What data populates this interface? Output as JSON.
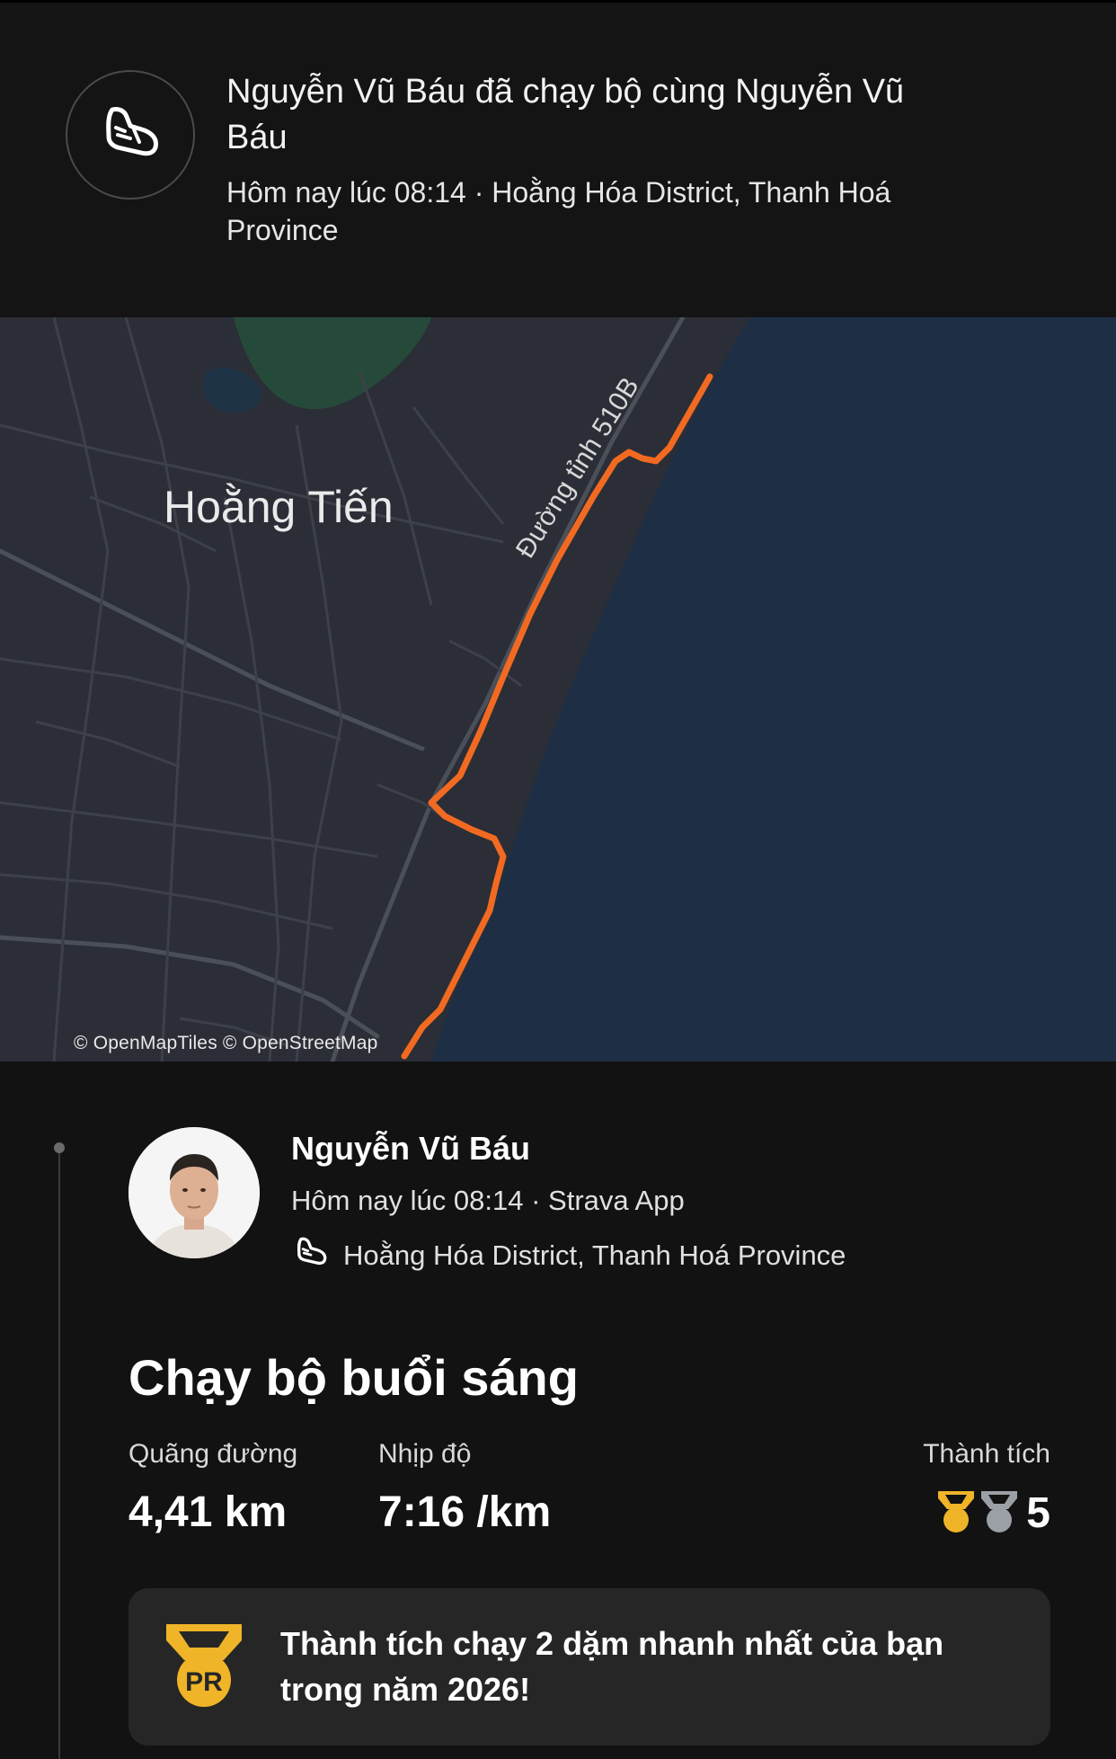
{
  "header": {
    "title": "Nguyễn Vũ Báu đã chạy bộ cùng Nguyễn Vũ Báu",
    "subtitle": "Hôm nay lúc 08:14 · Hoằng Hóa District, Thanh Hoá Province",
    "icon": "running-shoe-icon"
  },
  "map": {
    "place_label": "Hoằng Tiến",
    "road_label": "Đường tỉnh 510B",
    "credit": "© OpenMapTiles © OpenStreetMap",
    "route_color": "#f26a21",
    "water_color": "#1e2f45",
    "land_color": "#2b2e36"
  },
  "activity": {
    "athlete_name": "Nguyễn Vũ Báu",
    "meta": "Hôm nay lúc 08:14 · Strava App",
    "location": "Hoằng Hóa District, Thanh Hoá Province",
    "title": "Chạy bộ buổi sáng",
    "stats": {
      "distance_label": "Quãng đường",
      "distance_value": "4,41 km",
      "pace_label": "Nhịp độ",
      "pace_value": "7:16 /km",
      "achievements_label": "Thành tích",
      "achievements_count": "5"
    },
    "pr_card": {
      "badge_text": "PR",
      "message": "Thành tích chạy 2 dặm nhanh nhất của bạn trong năm 2026!"
    },
    "colors": {
      "gold": "#f0b429",
      "silver": "#9aa0a6"
    }
  }
}
